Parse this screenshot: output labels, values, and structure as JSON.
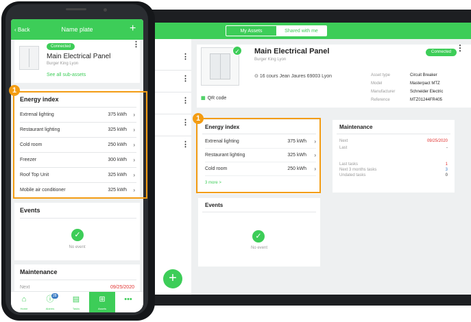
{
  "tablet": {
    "tabs": [
      "My Assets",
      "Shared with me"
    ],
    "asset": {
      "title": "Main Electrical Panel",
      "subtitle": "Burger King Lyon",
      "address": "16 cours Jean Jaures 69003 Lyon",
      "status": "Connected",
      "qr_label": "QR code",
      "specs": [
        {
          "label": "Asset type",
          "value": "Circuit Breaker"
        },
        {
          "label": "Model",
          "value": "Masterpact MTZ"
        },
        {
          "label": "Manufacturer",
          "value": "Schneider Electric"
        },
        {
          "label": "Reference",
          "value": "MTZ01244FR405"
        }
      ]
    },
    "energy": {
      "title": "Energy index",
      "rows": [
        {
          "name": "Extrenal lighting",
          "value": "375 kWh"
        },
        {
          "name": "Restaurant lighting",
          "value": "325 kWh"
        },
        {
          "name": "Cold room",
          "value": "250 kWh"
        }
      ],
      "more": "3 more >"
    },
    "maintenance": {
      "title": "Maintenance",
      "next_label": "Next",
      "next_value": "09/25/2020",
      "last_label": "Last",
      "last_value": "-",
      "last_tasks_label": "Last tasks",
      "last_tasks_value": "1",
      "next3_label": "Next 3 months tasks",
      "next3_value": "3",
      "undated_label": "Undated tasks",
      "undated_value": "0"
    },
    "events": {
      "title": "Events",
      "empty": "No event"
    },
    "fab": "+"
  },
  "phone": {
    "back": "Back",
    "title": "Name plate",
    "plus": "+",
    "asset": {
      "status": "Connected",
      "name": "Main Electrical Panel",
      "subtitle": "Burger King Lyon",
      "see_all": "See all sub-assets"
    },
    "energy": {
      "title": "Energy index",
      "rows": [
        {
          "name": "Extrenal lighting",
          "value": "375 kWh"
        },
        {
          "name": "Restaurant lighting",
          "value": "325 kWh"
        },
        {
          "name": "Cold room",
          "value": "250 kWh"
        },
        {
          "name": "Freezer",
          "value": "300 kWh"
        },
        {
          "name": "Roof Top Unit",
          "value": "325 kWh"
        },
        {
          "name": "Mobile air conditioner",
          "value": "325 kWh"
        }
      ]
    },
    "events": {
      "title": "Events",
      "empty": "No event"
    },
    "maintenance": {
      "title": "Maintenance",
      "next_label": "Next",
      "next_value": "09/25/2020"
    },
    "nav": [
      {
        "label": "Home",
        "icon": "home-icon"
      },
      {
        "label": "Alarms",
        "icon": "alarm-icon",
        "badge": "28"
      },
      {
        "label": "Tasks",
        "icon": "tasks-icon"
      },
      {
        "label": "Assets",
        "icon": "assets-icon"
      },
      {
        "label": "",
        "icon": "more-icon"
      }
    ]
  },
  "callouts": [
    "1",
    "1"
  ],
  "colors": {
    "brand_green": "#3dcd58",
    "callout_orange": "#f39c12",
    "alert_red": "#e1302e"
  }
}
